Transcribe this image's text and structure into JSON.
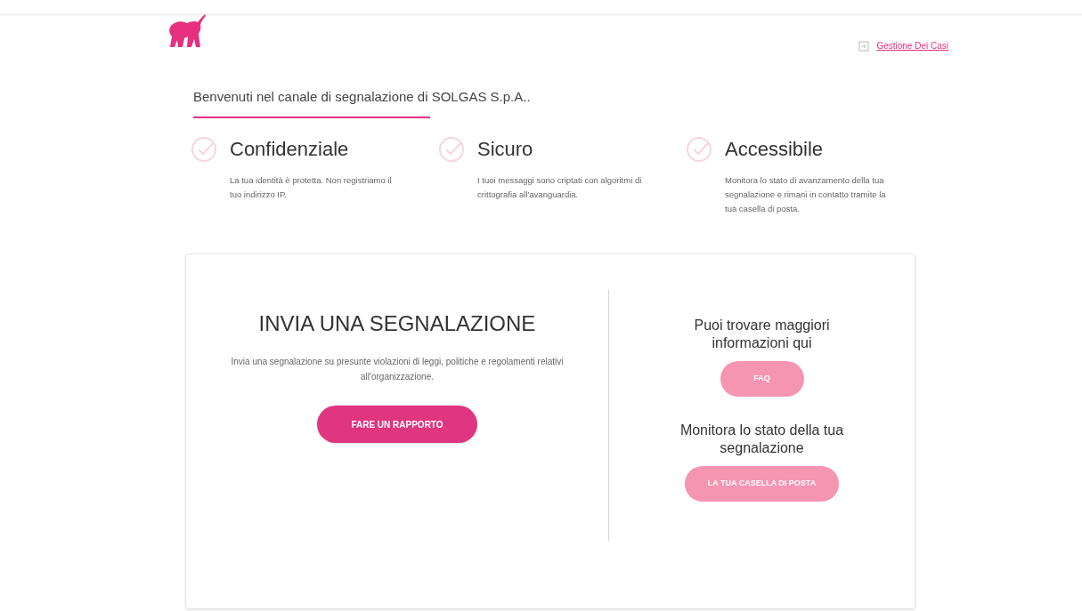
{
  "header": {
    "link": "Gestione Dei Casi"
  },
  "welcome": "Benvenuti nel canale di segnalazione di SOLGAS S.p.A..",
  "features": [
    {
      "title": "Confidenziale",
      "text": "La tua identità è protetta. Non registriamo il tuo indirizzo IP."
    },
    {
      "title": "Sicuro",
      "text": "I tuoi messaggi sono criptati con algoritmi di crittografia all'avanguardia."
    },
    {
      "title": "Accessibile",
      "text": "Monitora lo stato di avanzamento della tua segnalazione e rimani in contatto tramite la tua casella di posta."
    }
  ],
  "report": {
    "title": "INVIA UNA SEGNALAZIONE",
    "text": "Invia una segnalazione su presunte violazioni di leggi, politiche e regolamenti relativi all'organizzazione.",
    "button": "FARE UN RAPPORTO"
  },
  "info": [
    {
      "text": "Puoi trovare maggiori informazioni qui",
      "button": "FAQ"
    },
    {
      "text": "Monitora lo stato della tua segnalazione",
      "button": "LA TUA CASELLA DI POSTA"
    }
  ]
}
